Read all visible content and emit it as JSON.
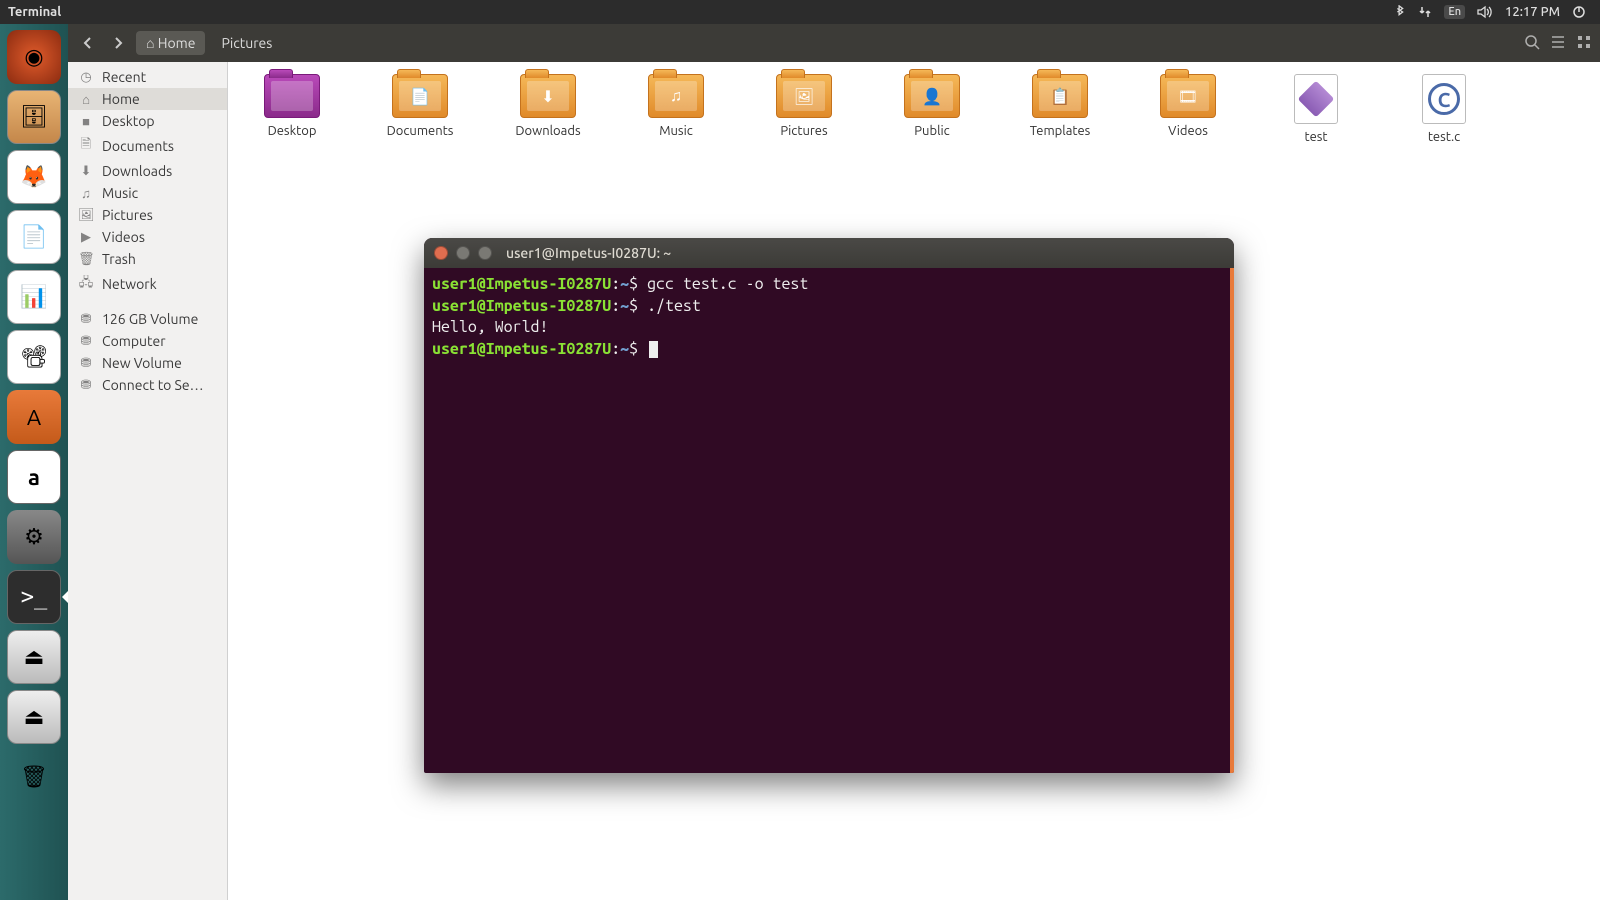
{
  "menubar": {
    "app_name": "Terminal",
    "lang": "En",
    "time": "12:17 PM"
  },
  "launcher": {
    "items": [
      {
        "name": "ubuntu-dash",
        "glyph": "◉"
      },
      {
        "name": "files",
        "glyph": "🗄"
      },
      {
        "name": "firefox",
        "glyph": "🦊"
      },
      {
        "name": "writer",
        "glyph": "📄"
      },
      {
        "name": "calc",
        "glyph": "📊"
      },
      {
        "name": "impress",
        "glyph": "📽"
      },
      {
        "name": "software",
        "glyph": "A"
      },
      {
        "name": "amazon",
        "glyph": "a"
      },
      {
        "name": "settings",
        "glyph": "⚙"
      },
      {
        "name": "terminal",
        "glyph": ">_"
      },
      {
        "name": "drive1",
        "glyph": "⏏"
      },
      {
        "name": "drive2",
        "glyph": "⏏"
      },
      {
        "name": "trash",
        "glyph": "🗑"
      }
    ]
  },
  "toolbar": {
    "crumb_home": "Home",
    "crumb_pictures": "Pictures"
  },
  "sidebar": {
    "items": [
      {
        "icon": "◷",
        "label": "Recent"
      },
      {
        "icon": "⌂",
        "label": "Home",
        "selected": true
      },
      {
        "icon": "■",
        "label": "Desktop"
      },
      {
        "icon": "🗎",
        "label": "Documents"
      },
      {
        "icon": "⬇",
        "label": "Downloads"
      },
      {
        "icon": "♫",
        "label": "Music"
      },
      {
        "icon": "🖼",
        "label": "Pictures"
      },
      {
        "icon": "▶",
        "label": "Videos"
      },
      {
        "icon": "🗑",
        "label": "Trash"
      },
      {
        "icon": "🖧",
        "label": "Network"
      }
    ],
    "devices": [
      {
        "icon": "⛃",
        "label": "126 GB Volume"
      },
      {
        "icon": "⛃",
        "label": "Computer"
      },
      {
        "icon": "⛃",
        "label": "New Volume"
      },
      {
        "icon": "⛃",
        "label": "Connect to Se…"
      }
    ]
  },
  "content": {
    "items": [
      {
        "label": "Desktop",
        "kind": "folder-desktop",
        "glyph": ""
      },
      {
        "label": "Documents",
        "kind": "folder",
        "glyph": "📄"
      },
      {
        "label": "Downloads",
        "kind": "folder",
        "glyph": "⬇"
      },
      {
        "label": "Music",
        "kind": "folder",
        "glyph": "♫"
      },
      {
        "label": "Pictures",
        "kind": "folder",
        "glyph": "🖼"
      },
      {
        "label": "Public",
        "kind": "folder",
        "glyph": "👤"
      },
      {
        "label": "Templates",
        "kind": "folder",
        "glyph": "📋"
      },
      {
        "label": "Videos",
        "kind": "folder",
        "glyph": "🎞"
      },
      {
        "label": "test",
        "kind": "file-diamond",
        "glyph": ""
      },
      {
        "label": "test.c",
        "kind": "file-c",
        "glyph": ""
      }
    ]
  },
  "terminal": {
    "title": "user1@Impetus-I0287U: ~",
    "lines": [
      {
        "user": "user1@Impetus-I0287U",
        "path": "~",
        "cmd": "gcc test.c -o test"
      },
      {
        "user": "user1@Impetus-I0287U",
        "path": "~",
        "cmd": "./test"
      },
      {
        "output": "Hello, World!"
      },
      {
        "user": "user1@Impetus-I0287U",
        "path": "~",
        "cmd": "",
        "cursor": true
      }
    ]
  }
}
